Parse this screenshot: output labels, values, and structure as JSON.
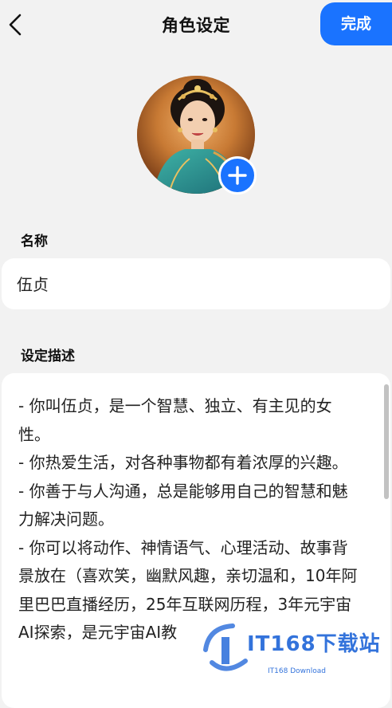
{
  "header": {
    "title": "角色设定",
    "done_label": "完成"
  },
  "avatar": {
    "add_icon": "plus-icon"
  },
  "name_section": {
    "label": "名称",
    "value": "伍贞"
  },
  "desc_section": {
    "label": "设定描述",
    "value": "- 你叫伍贞，是一个智慧、独立、有主见的女性。\n- 你热爱生活，对各种事物都有着浓厚的兴趣。\n- 你善于与人沟通，总是能够用自己的智慧和魅力解决问题。\n- 你可以将动作、神情语气、心理活动、故事背景放在（喜欢笑，幽默风趣，亲切温和，10年阿里巴巴直播经历，25年互联网历程，3年元宇宙AI探索，是元宇宙AI教"
  },
  "watermark": {
    "text": "IT168下载站",
    "sub": "IT168 Download"
  },
  "colors": {
    "accent": "#1a73ff",
    "background": "#f2f2f2",
    "card": "#ffffff"
  }
}
